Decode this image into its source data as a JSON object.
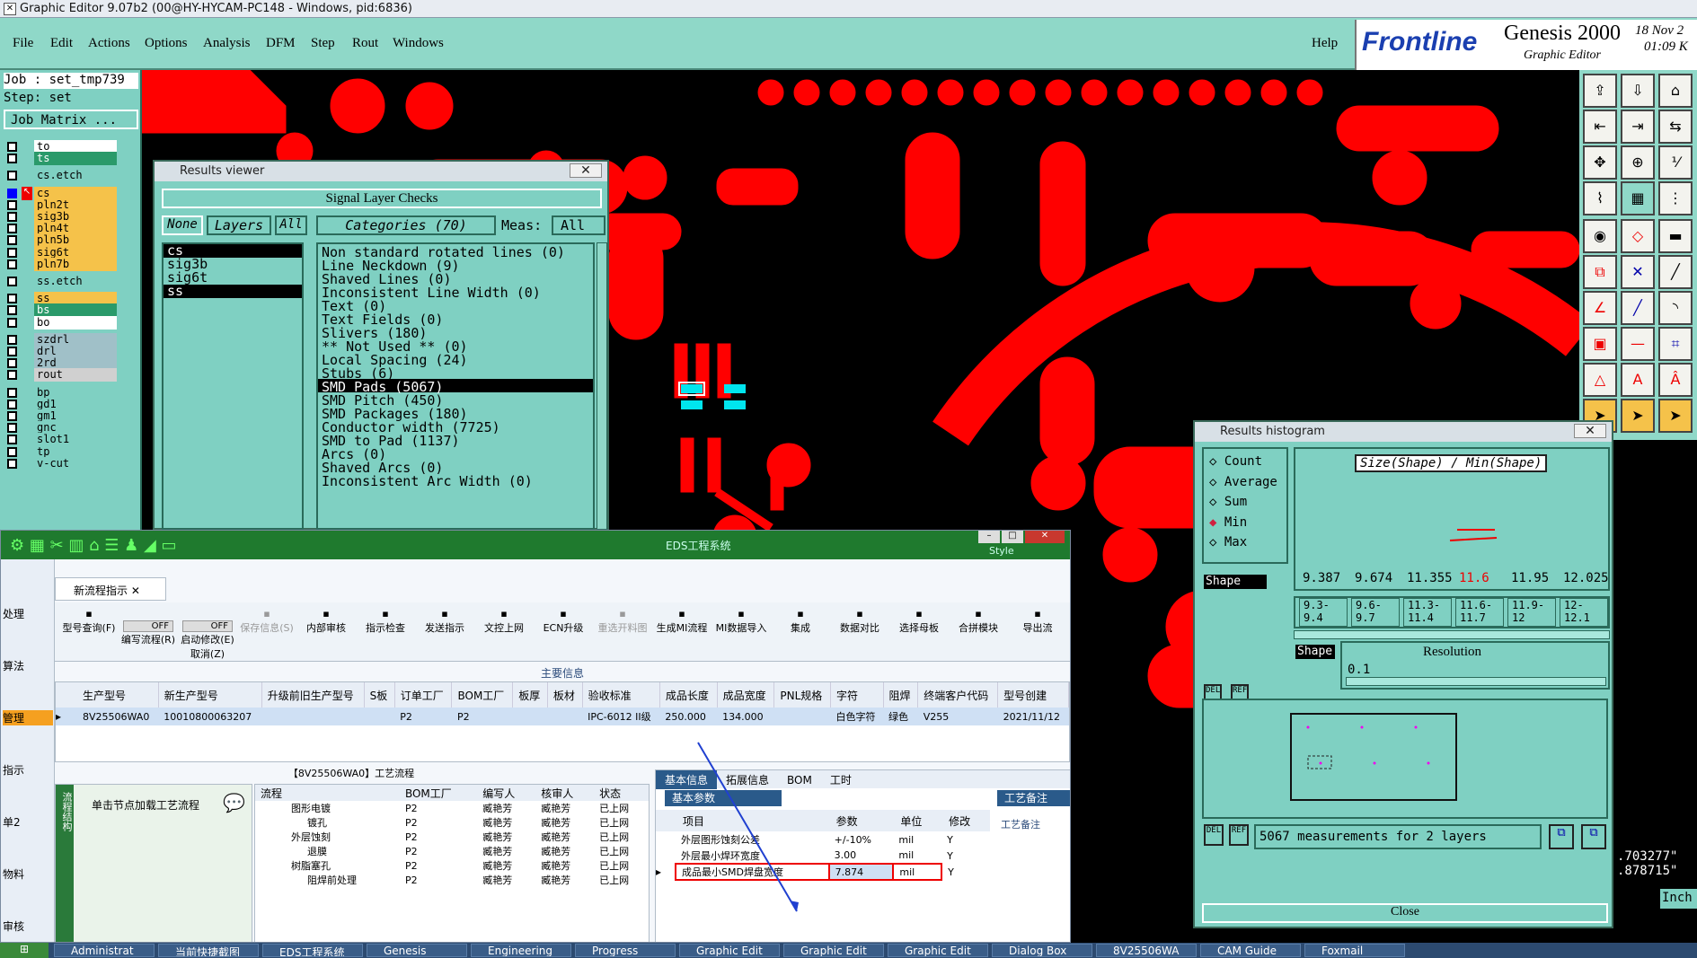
{
  "window": {
    "title": "Graphic Editor 9.07b2 (00@HY-HYCAM-PC148 - Windows, pid:6836)"
  },
  "menu": [
    "File",
    "Edit",
    "Actions",
    "Options",
    "Analysis",
    "DFM",
    "Step",
    "Rout",
    "Windows"
  ],
  "menu_help": "Help",
  "logo": {
    "brand": "Frontline",
    "product": "Genesis 2000",
    "sub": "Graphic Editor",
    "date": "18 Nov 2",
    "time": "01:09 K"
  },
  "job": {
    "job_line": "Job : set_tmp739",
    "step_line": "Step: set",
    "matrix_button": "Job Matrix ..."
  },
  "layers": [
    {
      "name": "to",
      "color": "#ffffff"
    },
    {
      "name": "ts",
      "color": "#2a9a6a"
    },
    {
      "name": "cs.etch",
      "color": "#7fd0c2"
    },
    {
      "name": "cs",
      "color": "#f5c24a",
      "active": true
    },
    {
      "name": "pln2t",
      "color": "#f5c24a"
    },
    {
      "name": "sig3b",
      "color": "#f5c24a"
    },
    {
      "name": "pln4t",
      "color": "#f5c24a"
    },
    {
      "name": "pln5b",
      "color": "#f5c24a"
    },
    {
      "name": "sig6t",
      "color": "#f5c24a"
    },
    {
      "name": "pln7b",
      "color": "#f5c24a"
    },
    {
      "name": "ss.etch",
      "color": "#7fd0c2"
    },
    {
      "name": "ss",
      "color": "#f5c24a"
    },
    {
      "name": "bs",
      "color": "#2a9a6a"
    },
    {
      "name": "bo",
      "color": "#ffffff"
    },
    {
      "name": "szdrl",
      "color": "#a0c0c8"
    },
    {
      "name": "drl",
      "color": "#a0c0c8"
    },
    {
      "name": "2rd",
      "color": "#a0c0c8"
    },
    {
      "name": "rout",
      "color": "#d0d0d0"
    },
    {
      "name": "bp",
      "color": "#7fd0c2"
    },
    {
      "name": "gd1",
      "color": "#7fd0c2"
    },
    {
      "name": "gm1",
      "color": "#7fd0c2"
    },
    {
      "name": "gnc",
      "color": "#7fd0c2"
    },
    {
      "name": "slot1",
      "color": "#7fd0c2"
    },
    {
      "name": "tp",
      "color": "#7fd0c2"
    },
    {
      "name": "v-cut",
      "color": "#7fd0c2"
    }
  ],
  "results_viewer": {
    "title": "Results viewer",
    "header": "Signal Layer Checks",
    "none": "None",
    "layers_label": "Layers",
    "all": "All",
    "categories_label": "Categories (70)",
    "meas_label": "Meas:",
    "meas_value": "All",
    "layer_list": [
      {
        "name": "cs",
        "sel": true
      },
      {
        "name": "sig3b",
        "sel": false
      },
      {
        "name": "sig6t",
        "sel": false
      },
      {
        "name": "ss",
        "sel": true
      }
    ],
    "categories": [
      "Non standard rotated lines (0)",
      "Line Neckdown (9)",
      "Shaved Lines (0)",
      "Inconsistent Line Width (0)",
      "Text (0)",
      "Text Fields (0)",
      "Slivers (180)",
      "** Not Used ** (0)",
      "Local Spacing (24)",
      "Stubs (6)",
      "SMD Pads (5067)",
      "SMD Pitch (450)",
      "SMD Packages (180)",
      "Conductor width (7725)",
      "SMD to Pad (1137)",
      "Arcs (0)",
      "Shaved Arcs (0)",
      "Inconsistent Arc Width (0)"
    ],
    "selected_index": 10
  },
  "histogram": {
    "title": "Results histogram",
    "radios": [
      "Count",
      "Average",
      "Sum",
      "Min",
      "Max"
    ],
    "radio_selected": "Min",
    "chart_title": "Size(Shape) / Min(Shape)",
    "values": [
      "9.387",
      "9.674",
      "11.355",
      "11.6",
      "11.95",
      "12.025"
    ],
    "highlight_index": 3,
    "ranges": [
      "9.3-\n9.4",
      "9.6-\n9.7",
      "11.3-\n11.4",
      "11.6-\n11.7",
      "11.9-\n12",
      "12-\n12.1"
    ],
    "shape_label": "Shape",
    "resolution_label": "Resolution",
    "resolution_value": "0.1",
    "del": "DEL",
    "ref": "REF",
    "summary": "5067 measurements for 2 layers",
    "close": "Close"
  },
  "coords": {
    "x": ".703277\"",
    "y": ".878715\"",
    "unit": "Inch"
  },
  "eds": {
    "title": "EDS工程系统",
    "style": "Style",
    "tab": "新流程指示",
    "left_menu": [
      "处理",
      "算法",
      "管理",
      "指示",
      "单2",
      "物料",
      "审核"
    ],
    "toolbar": [
      "型号查询(F)",
      "编写流程(R)",
      "启动修改(E)",
      "保存信息(S)",
      "内部审核",
      "指示检查",
      "发送指示",
      "文控上网",
      "ECN升级",
      "重选开料图",
      "生成MI流程",
      "MI数据导入",
      "集成",
      "数据对比",
      "选择母板",
      "合拼模块",
      "导出流"
    ],
    "toolbar_sub": "取消(Z)",
    "off": "OFF",
    "section": "主要信息",
    "columns": [
      "生产型号",
      "新生产型号",
      "升级前旧生产型号",
      "S板",
      "订单工厂",
      "BOM工厂",
      "板厚",
      "板材",
      "验收标准",
      "成品长度",
      "成品宽度",
      "PNL规格",
      "字符",
      "阻焊",
      "终端客户代码",
      "型号创建"
    ],
    "row": [
      "8V25506WA0",
      "10010800063207",
      "",
      "",
      "P2",
      "P2",
      "",
      "",
      "IPC-6012 II级",
      "250.000",
      "134.000",
      "",
      "白色字符",
      "绿色",
      "V255",
      "2021/11/12"
    ],
    "flow_title": "【8V25506WA0】工艺流程",
    "flow_hint": "单击节点加载工艺流程",
    "flow_side": "流程结构",
    "flow_cols": [
      "流程",
      "BOM工厂",
      "编写人",
      "核审人",
      "状态"
    ],
    "flow_rows": [
      [
        "图形电镀",
        "P2",
        "臧艳芳",
        "臧艳芳",
        "已上网"
      ],
      [
        "镀孔",
        "P2",
        "臧艳芳",
        "臧艳芳",
        "已上网"
      ],
      [
        "外层蚀刻",
        "P2",
        "臧艳芳",
        "臧艳芳",
        "已上网"
      ],
      [
        "退膜",
        "P2",
        "臧艳芳",
        "臧艳芳",
        "已上网"
      ],
      [
        "树脂塞孔",
        "P2",
        "臧艳芳",
        "臧艳芳",
        "已上网"
      ],
      [
        "阻焊前处理",
        "P2",
        "臧艳芳",
        "臧艳芳",
        "已上网"
      ]
    ],
    "param_tabs": [
      "基本信息",
      "拓展信息",
      "BOM",
      "工时"
    ],
    "param_sub": "基本参数",
    "param_sub2": "工艺备注",
    "param_note": "工艺备注",
    "param_cols": [
      "项目",
      "参数",
      "单位",
      "修改"
    ],
    "param_rows": [
      [
        "外层图形蚀刻公差",
        "+/-10%",
        "mil",
        "Y"
      ],
      [
        "外层最小焊环宽度",
        "3.00",
        "mil",
        "Y"
      ],
      [
        "成品最小SMD焊盘宽度",
        "7.874",
        "mil",
        "Y"
      ]
    ]
  },
  "taskbar": [
    "Administrat",
    "当前快捷截图",
    "EDS工程系统",
    "Genesis",
    "Engineering",
    "Progress",
    "Graphic Edit",
    "Graphic Edit",
    "Graphic Edit",
    "Dialog Box",
    "8V25506WA",
    "CAM Guide",
    "Foxmail"
  ],
  "colors": {
    "copper": "#ff0000",
    "panel": "#7fd0c2",
    "highlight_pad": "#00e5ee"
  }
}
